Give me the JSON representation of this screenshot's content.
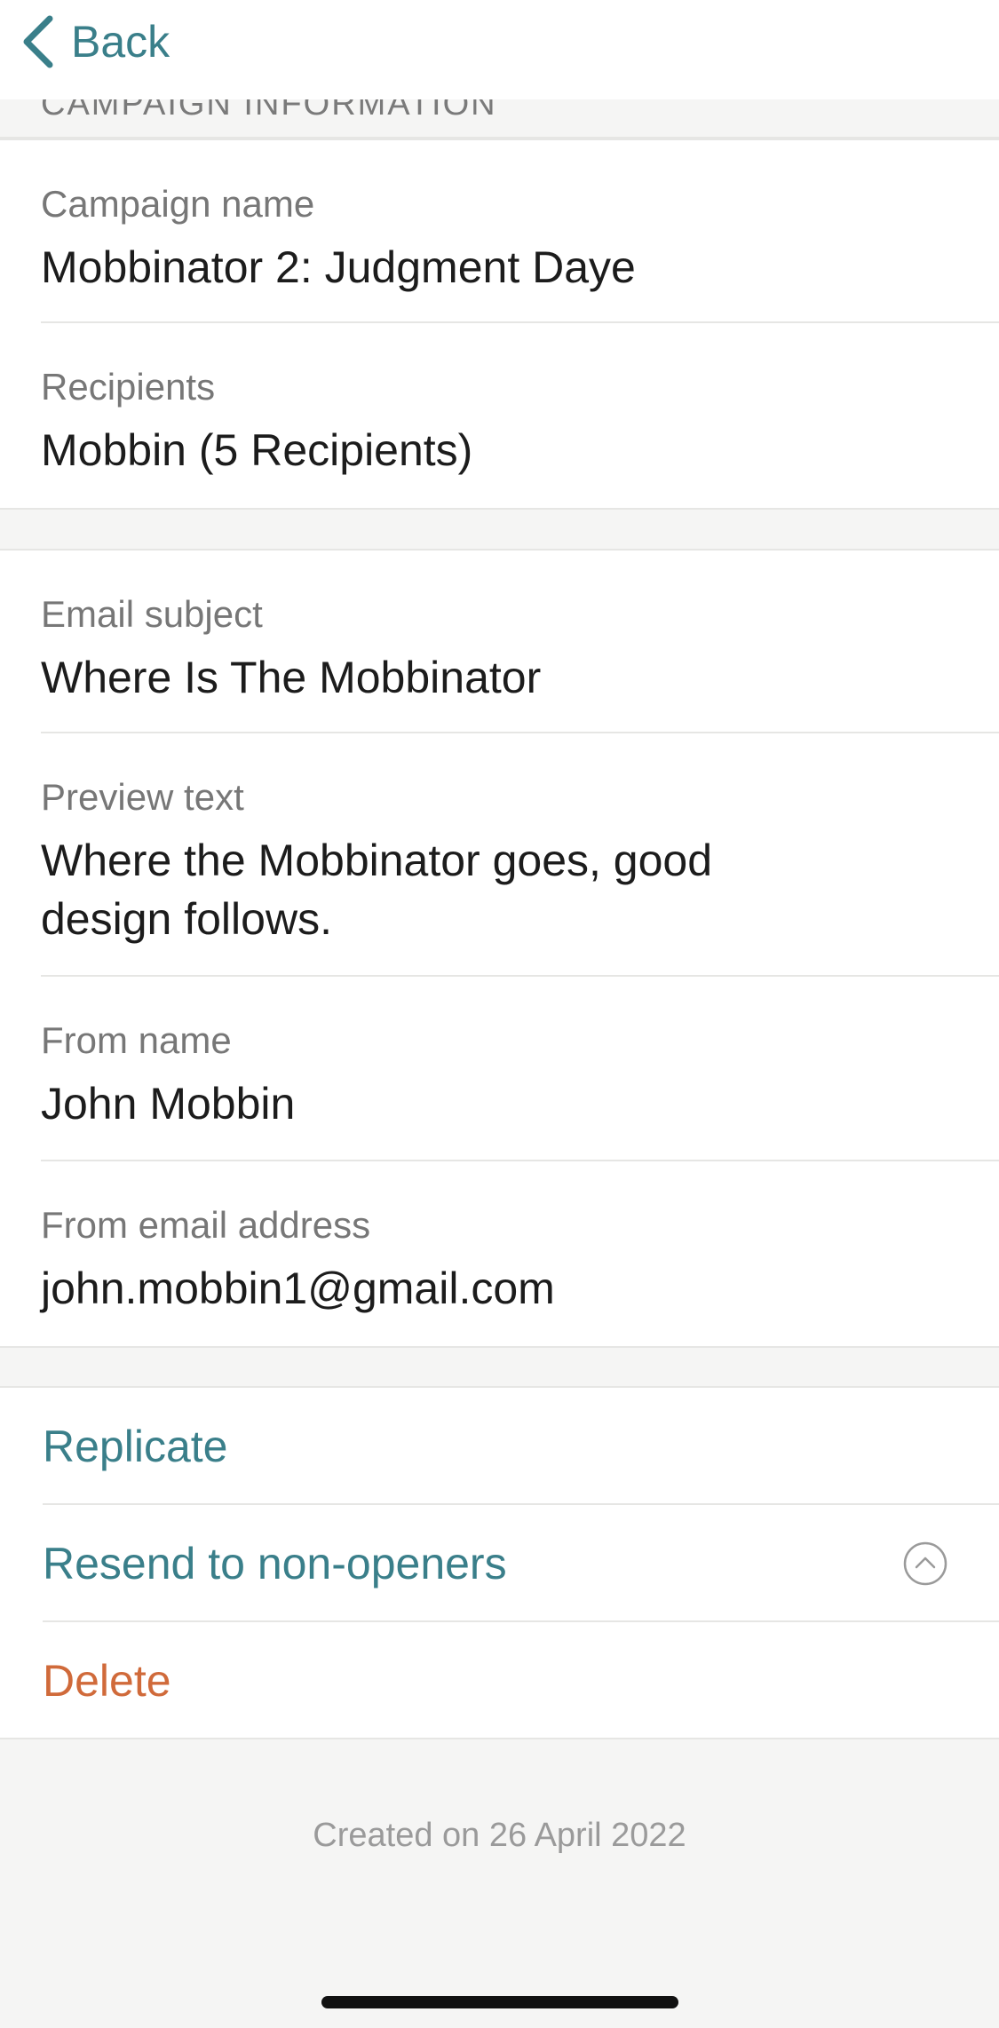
{
  "nav": {
    "back_label": "Back"
  },
  "section_header": "CAMPAIGN INFORMATION",
  "campaign": {
    "name_label": "Campaign name",
    "name_value": "Mobbinator 2: Judgment Daye",
    "recipients_label": "Recipients",
    "recipients_value": "Mobbin (5 Recipients)"
  },
  "email": {
    "subject_label": "Email subject",
    "subject_value": "Where Is The Mobbinator",
    "preview_label": "Preview text",
    "preview_value": "Where the Mobbinator goes, good design follows.",
    "from_name_label": "From name",
    "from_name_value": "John Mobbin",
    "from_email_label": "From email address",
    "from_email_value": "john.mobbin1@gmail.com"
  },
  "actions": {
    "replicate": "Replicate",
    "resend": "Resend to non-openers",
    "delete": "Delete"
  },
  "footer": {
    "created": "Created on 26 April 2022"
  },
  "colors": {
    "accent": "#3a7f8a",
    "danger": "#d06a3a",
    "background": "#f5f5f4"
  },
  "icons": {
    "back": "chevron-left-icon",
    "resend": "chevron-up-circle-icon"
  }
}
